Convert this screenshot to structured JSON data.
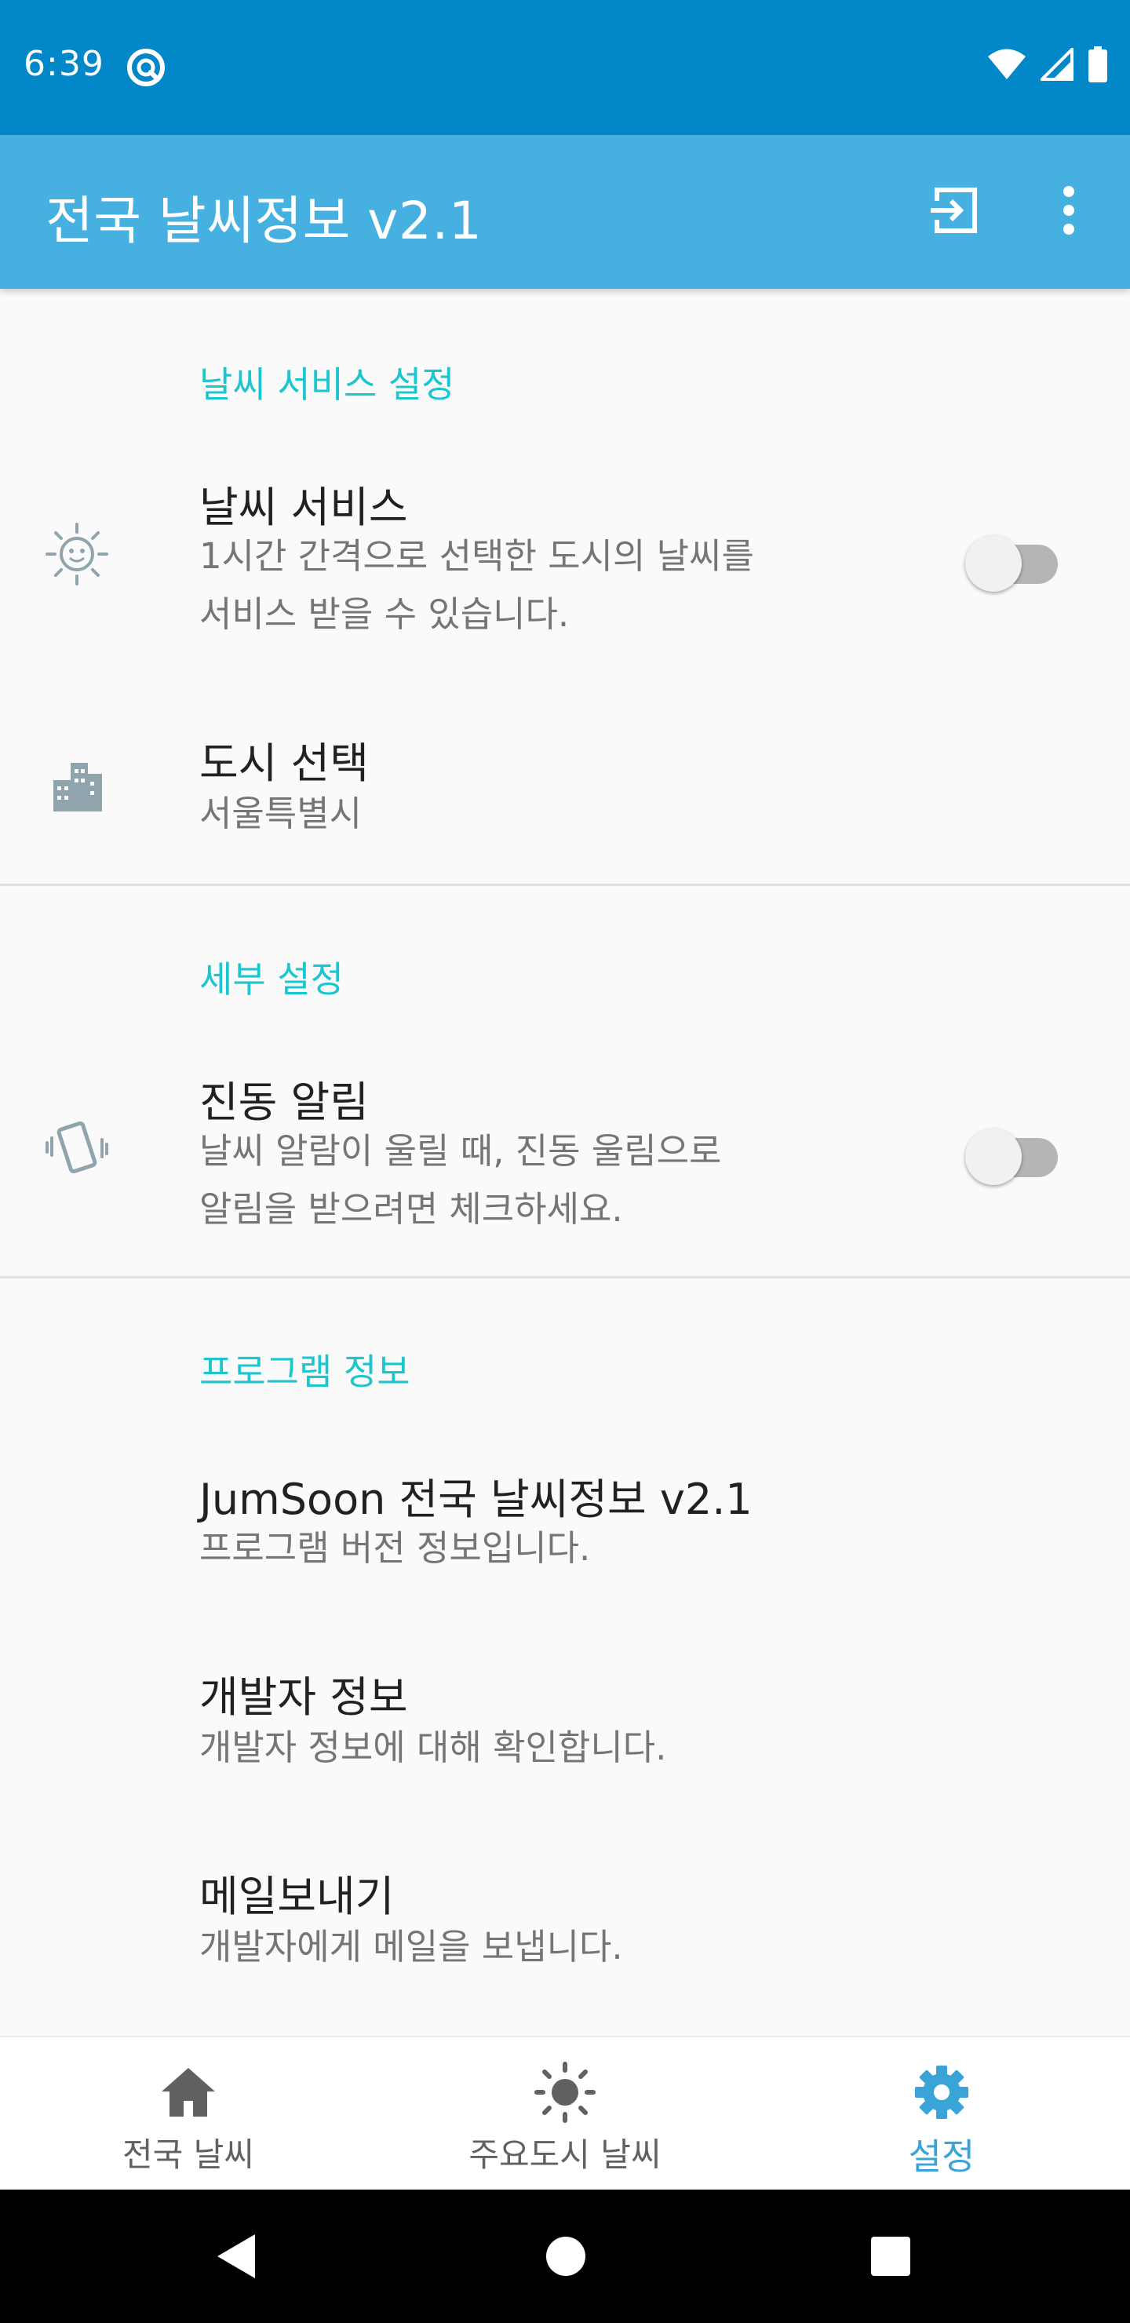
{
  "status_bar": {
    "time": "6:39",
    "icons": [
      "app-notification-icon",
      "wifi-icon",
      "signal-icon",
      "battery-icon"
    ]
  },
  "app_bar": {
    "title": "전국 날씨정보 v2.1",
    "actions": [
      "import-icon",
      "more-vert-icon"
    ]
  },
  "sections": {
    "weather_service": {
      "header": "날씨 서비스 설정",
      "weather_service_pref": {
        "title": "날씨 서비스",
        "summary_line1": "1시간 간격으로 선택한 도시의 날씨를",
        "summary_line2": "서비스 받을 수 있습니다.",
        "enabled": false
      },
      "city_pref": {
        "title": "도시 선택",
        "summary": "서울특별시"
      }
    },
    "detail": {
      "header": "세부 설정",
      "vibration_pref": {
        "title": "진동 알림",
        "summary_line1": "날씨 알람이 울릴 때, 진동 울림으로",
        "summary_line2": "알림을 받으려면 체크하세요.",
        "enabled": false
      }
    },
    "program_info": {
      "header": "프로그램 정보",
      "version_pref": {
        "title": "JumSoon 전국 날씨정보 v2.1",
        "summary": "프로그램 버전 정보입니다."
      },
      "developer_pref": {
        "title": "개발자 정보",
        "summary": "개발자 정보에 대해 확인합니다."
      },
      "mail_pref": {
        "title": "메일보내기",
        "summary": "개발자에게 메일을 보냅니다."
      }
    }
  },
  "bottom_nav": {
    "items": [
      {
        "label": "전국 날씨",
        "icon": "home-icon",
        "active": false
      },
      {
        "label": "주요도시 날씨",
        "icon": "sun-icon",
        "active": false
      },
      {
        "label": "설정",
        "icon": "gear-icon",
        "active": true
      }
    ]
  },
  "colors": {
    "status_bar": "#0288c8",
    "app_bar": "#46b0e0",
    "section_header": "#1cc6cf",
    "active_nav": "#3aa4d8"
  }
}
